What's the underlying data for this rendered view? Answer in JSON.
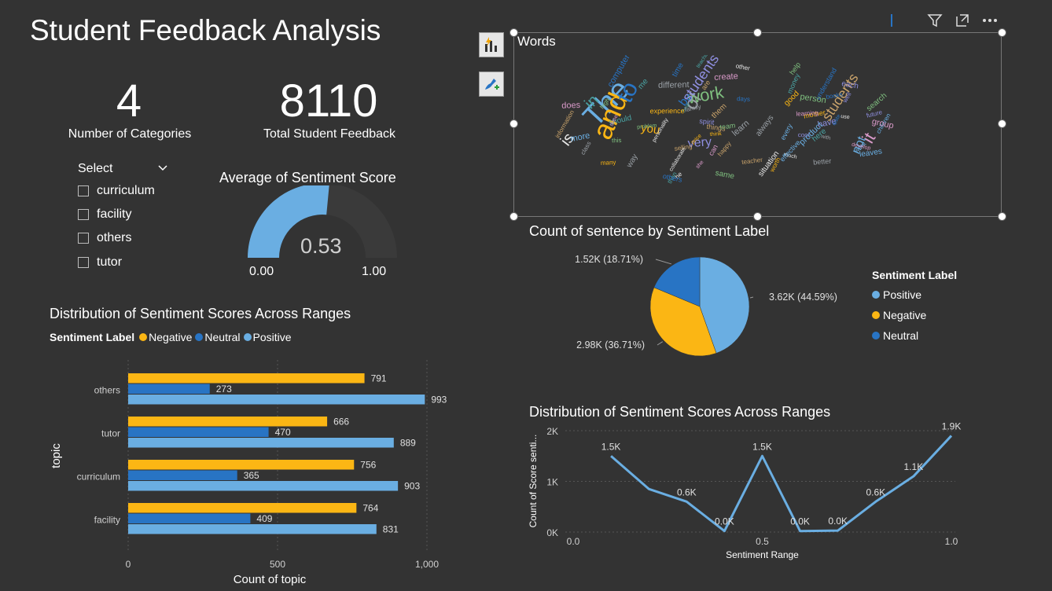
{
  "title": "Student Feedback Analysis",
  "kpis": {
    "categories_value": "4",
    "categories_label": "Number of Categories",
    "feedback_value": "8110",
    "feedback_label": "Total Student Feedback"
  },
  "slicer": {
    "label": "Select",
    "options": [
      "curriculum",
      "facility",
      "others",
      "tutor"
    ]
  },
  "gauge": {
    "title": "Average of Sentiment Score",
    "value": 0.53,
    "value_label": "0.53",
    "min_label": "0.00",
    "max_label": "1.00",
    "fill_color": "#6aaee2"
  },
  "wordcloud": {
    "title": "Words",
    "words": [
      "The",
      "and",
      "to",
      "of",
      "work",
      "it",
      "is",
      "in",
      "students",
      "very",
      "not",
      "you",
      "be",
      "with",
      "this",
      "can",
      "other",
      "me",
      "teacher",
      "have",
      "more",
      "good",
      "time",
      "learn",
      "help",
      "she",
      "he",
      "how",
      "things",
      "well",
      "want",
      "think",
      "understand",
      "different",
      "person",
      "does",
      "use",
      "should",
      "information",
      "students",
      "children",
      "worth",
      "books",
      "class",
      "problem",
      "develop",
      "personality",
      "teaching",
      "selling",
      "each",
      "every",
      "mother",
      "computer",
      "better",
      "high",
      "create",
      "much",
      "money",
      "happy",
      "future",
      "effective",
      "experience",
      "quite",
      "always",
      "search",
      "group",
      "collaborate",
      "than",
      "them",
      "cool",
      "product",
      "price",
      "others",
      "way",
      "same",
      "done",
      "situation",
      "here",
      "are",
      "spirit",
      "leaves",
      "many",
      "days",
      "family",
      "team",
      "learning"
    ]
  },
  "toolbar": {
    "filter_icon": "filter-icon",
    "focus_icon": "focus-mode-icon",
    "more_icon": "more-options-icon"
  },
  "pie": {
    "title": "Count of sentence by Sentiment Label",
    "legend_title": "Sentiment Label"
  },
  "bar": {
    "title": "Distribution of Sentiment Scores Across Ranges",
    "legend_title": "Sentiment Label"
  },
  "line": {
    "title": "Distribution of Sentiment Scores Across Ranges"
  },
  "chart_data": [
    {
      "type": "pie",
      "title": "Count of sentence by Sentiment Label",
      "legend": "right",
      "slices": [
        {
          "name": "Positive",
          "value": 3.62,
          "label": "3.62K (44.59%)",
          "color": "#6aaee2"
        },
        {
          "name": "Negative",
          "value": 2.98,
          "label": "2.98K (36.71%)",
          "color": "#fbb614"
        },
        {
          "name": "Neutral",
          "value": 1.52,
          "label": "1.52K (18.71%)",
          "color": "#2874c4"
        }
      ]
    },
    {
      "type": "bar",
      "orientation": "horizontal",
      "title": "Distribution of Sentiment Scores Across Ranges",
      "xlabel": "Count of topic",
      "ylabel": "topic",
      "xlim": [
        0,
        1000
      ],
      "xticks": [
        "0",
        "500",
        "1,000"
      ],
      "legend": "top-left",
      "categories": [
        "others",
        "tutor",
        "curriculum",
        "facility"
      ],
      "series": [
        {
          "name": "Negative",
          "color": "#fbb614",
          "values": [
            791,
            666,
            756,
            764
          ]
        },
        {
          "name": "Neutral",
          "color": "#2874c4",
          "values": [
            273,
            470,
            365,
            409
          ]
        },
        {
          "name": "Positive",
          "color": "#6aaee2",
          "values": [
            993,
            889,
            903,
            831
          ]
        }
      ]
    },
    {
      "type": "line",
      "title": "Distribution of Sentiment Scores Across Ranges",
      "xlabel": "Sentiment Range",
      "ylabel": "Count of Score senti...",
      "xlim": [
        0,
        1
      ],
      "ylim": [
        0,
        2000
      ],
      "xticks": [
        "0.0",
        "0.5",
        "1.0"
      ],
      "yticks": [
        "0K",
        "1K",
        "2K"
      ],
      "color": "#6aaee2",
      "x": [
        0.1,
        0.2,
        0.3,
        0.4,
        0.5,
        0.6,
        0.7,
        0.8,
        0.9,
        1.0
      ],
      "y": [
        1500,
        850,
        600,
        20,
        1500,
        20,
        30,
        600,
        1100,
        1900
      ],
      "point_labels": [
        "1.5K",
        "",
        "0.6K",
        "0.0K",
        "1.5K",
        "0.0K",
        "0.0K",
        "0.6K",
        "1.1K",
        "1.9K"
      ]
    }
  ]
}
